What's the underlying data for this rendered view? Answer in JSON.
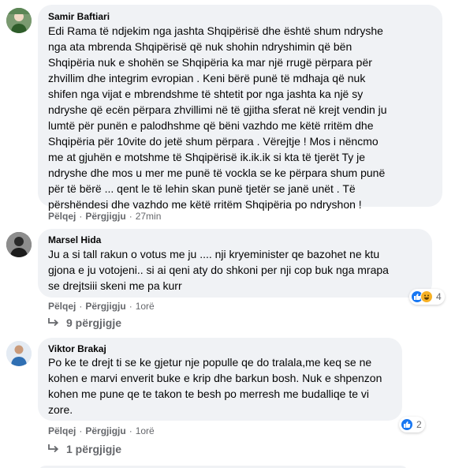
{
  "comments": [
    {
      "author": "Samir Baftiari",
      "lines": [
        "Edi Rama të ndjekim nga jashta Shqipërisë dhe është shum ndryshe",
        "nga ata mbrenda Shqipërisë që nuk shohin ndryshimin që bën",
        "Shqipëria nuk e shohën se Shqipëria ka mar një rrugë përpara për",
        "zhvillim dhe integrim evropian . Keni bërë punë të mdhaja që nuk",
        "shifen nga vijat e mbrendshme të shtetit por nga jashta ka një sy",
        "ndryshe që ecën përpara zhvillimi në të gjitha sferat në krejt vendin ju",
        "lumtë për punën e palodhshme që bëni vazhdo me këtë rritëm dhe",
        "Shqipëria për 10vite do jetë shum përpara . Vërejtje ! Mos i nëncmo",
        "me at gjuhën e motshme të Shqipërisë ik.ik.ik si kta të tjerët Ty je",
        "ndryshe dhe mos u mer me punë të vockla se ke përpara shum punë",
        "për të bërë ... qent le të lehin skan punë tjetër se janë unët . Të",
        "përshëndesi dhe vazhdo me këtë rritëm Shqipëria po ndryshon !"
      ],
      "like_label": "Pëlqej",
      "reply_label": "Përgjigju",
      "time": "27min"
    },
    {
      "author": "Marsel Hida",
      "lines": [
        "Ju a si tall rakun o votus me ju .... nji kryeminister qe bazohet ne ktu",
        "gjona e ju votojeni.. si ai qeni aty do shkoni per nji cop buk nga mrapa",
        "se drejtsiii skeni me pa kurr"
      ],
      "like_label": "Pëlqej",
      "reply_label": "Përgjigju",
      "time": "1orë",
      "reaction_count": "4",
      "replies_label": "9 përgjigje"
    },
    {
      "author": "Viktor Brakaj",
      "lines": [
        "Po ke te drejt ti se ke gjetur nje popullе qe do tralala,me keq se ne",
        "kohen e marvi enverit buke e krip dhe barkun bosh. Nuk e shpenzon",
        "kohen me pune qe te takon te besh po merresh me budalliqe te vi",
        "zore."
      ],
      "like_label": "Pëlqej",
      "reply_label": "Përgjigju",
      "time": "1orë",
      "reaction_count": "2",
      "replies_label": "1 përgjigje"
    }
  ],
  "colors": {
    "bubble": "#f0f2f5",
    "secondary_text": "#65676b",
    "like_blue": "#1877f2",
    "haha_yellow": "#f7b125"
  },
  "icons": {
    "like": "thumbs-up-icon",
    "haha": "laughing-face-icon",
    "reply_arrow": "reply-arrow-icon"
  }
}
